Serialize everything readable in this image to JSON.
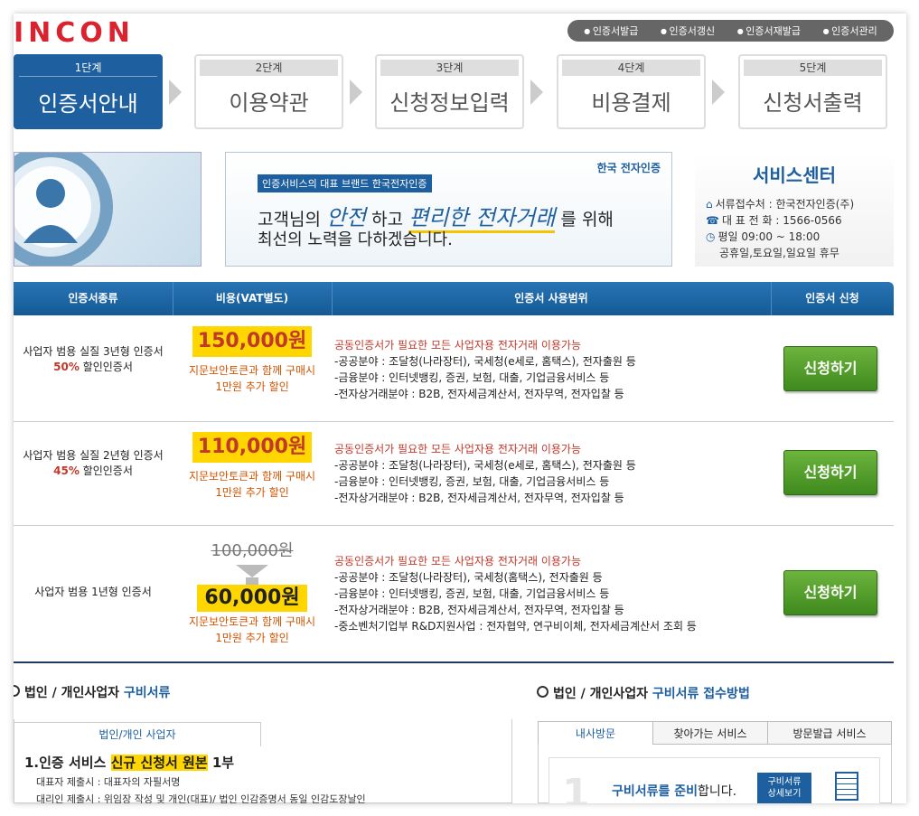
{
  "logo": "INCON",
  "topnav": [
    "인증서발급",
    "인증서갱신",
    "인증서재발급",
    "인증서관리"
  ],
  "steps": [
    {
      "num": "1단계",
      "title": "인증서안내"
    },
    {
      "num": "2단계",
      "title": "이용약관"
    },
    {
      "num": "3단계",
      "title": "신청정보입력"
    },
    {
      "num": "4단계",
      "title": "비용결제"
    },
    {
      "num": "5단계",
      "title": "신청서출력"
    }
  ],
  "banner": {
    "tag": "인증서비스의 대표 브랜드 한국전자인증",
    "brand": "한국 전자인증",
    "line1_a": "고객님의 ",
    "line1_b": "안전",
    "line1_c": " 하고 ",
    "line1_d": "편리한 전자거래",
    "line1_e": " 를 위해",
    "line2": "최선의 노력을 다하겠습니다."
  },
  "service_center": {
    "title": "서비스센터",
    "lines": [
      "서류접수처 : 한국전자인증(주)",
      "대 표 전 화 : 1566-0566",
      "평일 09:00 ~ 18:00",
      "공휴일,토요일,일요일 휴무"
    ]
  },
  "table": {
    "headers": [
      "인증서종류",
      "비용(VAT별도)",
      "인증서 사용범위",
      "인증서 신청"
    ],
    "rows": [
      {
        "type_line1": "사업자 범용 실질 3년형 인증서",
        "disc": "50%",
        "disc_rest": " 할인인증서",
        "price": "150,000원",
        "note1": "지문보안토큰과 함께 구매시",
        "note2": "1만원 추가 할인",
        "scope": [
          "공동인증서가 필요한 모든 사업자용 전자거래 이용가능",
          "-공공분야 : 조달청(나라장터), 국세청(e세로, 홈택스), 전자출원 등",
          "-금융분야 : 인터넷뱅킹, 증권, 보험, 대출, 기업금융서비스 등",
          "-전자상거래분야 : B2B, 전자세금계산서, 전자무역, 전자입찰 등"
        ],
        "button": "신청하기"
      },
      {
        "type_line1": "사업자 범용 실질 2년형 인증서",
        "disc": "45%",
        "disc_rest": " 할인인증서",
        "price": "110,000원",
        "note1": "지문보안토큰과 함께 구매시",
        "note2": "1만원 추가 할인",
        "scope": [
          "공동인증서가 필요한 모든 사업자용 전자거래 이용가능",
          "-공공분야 : 조달청(나라장터), 국세청(e세로, 홈택스), 전자출원 등",
          "-금융분야 : 인터넷뱅킹, 증권, 보험, 대출, 기업금융서비스 등",
          "-전자상거래분야 : B2B, 전자세금계산서, 전자무역, 전자입찰 등"
        ],
        "button": "신청하기"
      },
      {
        "type_line1": "사업자 범용 1년형 인증서",
        "old_price": "100,000원",
        "price": "60,000원",
        "note1": "지문보안토큰과 함께 구매시",
        "note2": "1만원 추가 할인",
        "scope": [
          "공동인증서가 필요한 모든 사업자용 전자거래 이용가능",
          "-공공분야 : 조달청(나라장터), 국세청(홈택스), 전자출원 등",
          "-금융분야 : 인터넷뱅킹, 증권, 보험, 대출, 기업금융서비스 등",
          "-전자상거래분야 : B2B, 전자세금계산서, 전자무역, 전자입찰 등",
          "-중소벤처기업부 R&D지원사업 : 전자협약, 연구비이체, 전자세금계산서 조회 등"
        ],
        "button": "신청하기"
      }
    ]
  },
  "docs": {
    "title_a": "법인 / 개인사업자 ",
    "title_b": "구비서류",
    "tab": "법인/개인 사업자",
    "item_num": "1.인증 서비스 ",
    "item_hl": "신규 신청서 원본",
    "item_rest": " 1부",
    "sub1": "대표자 제출시 : 대표자의 자필서명",
    "sub2": "대리인 제출시 : 위임장 작성 및 개인(대표)/ 법인 인감증명서 동일 인감도장날인"
  },
  "method": {
    "title_a": "법인 / 개인사업자 ",
    "title_b": "구비서류 접수방법",
    "tabs": [
      "내사방문",
      "찾아가는 서비스",
      "방문발급 서비스"
    ],
    "bignum": "1",
    "text_a": "구비서류를 준비",
    "text_b": "합니다.",
    "btn_line1": "구비서류",
    "btn_line2": "상세보기"
  }
}
